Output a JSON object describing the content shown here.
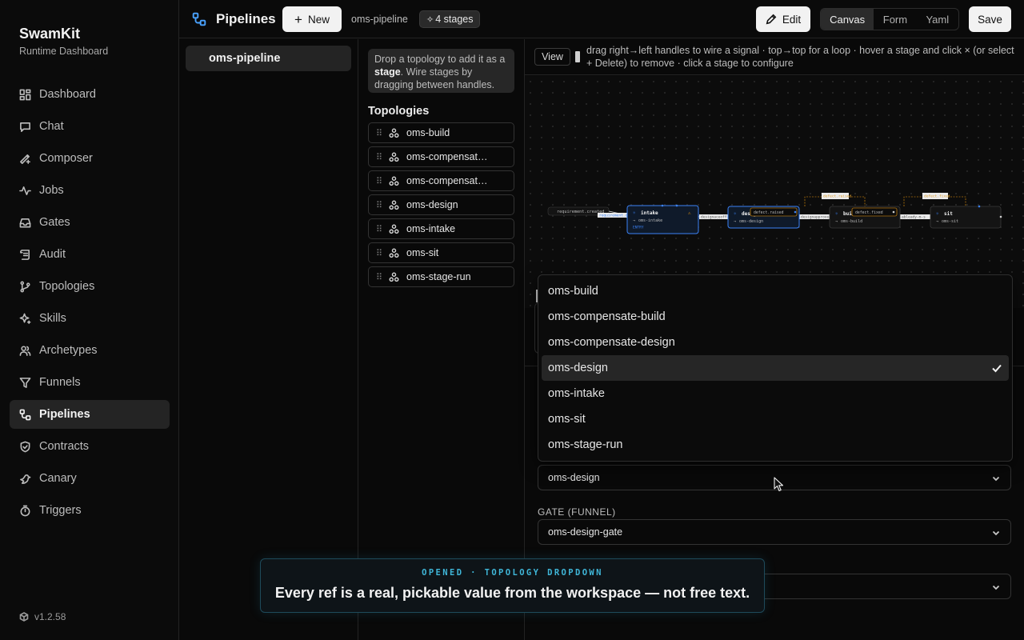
{
  "brand": {
    "name": "SwamKit",
    "subtitle": "Runtime Dashboard",
    "version": "v1.2.58"
  },
  "nav": [
    {
      "label": "Dashboard",
      "icon": "dashboard-icon",
      "active": false
    },
    {
      "label": "Chat",
      "icon": "chat-icon",
      "active": false
    },
    {
      "label": "Composer",
      "icon": "composer-icon",
      "active": false
    },
    {
      "label": "Jobs",
      "icon": "activity-icon",
      "active": false
    },
    {
      "label": "Gates",
      "icon": "inbox-icon",
      "active": false
    },
    {
      "label": "Audit",
      "icon": "scroll-icon",
      "active": false
    },
    {
      "label": "Topologies",
      "icon": "git-branch-icon",
      "active": false
    },
    {
      "label": "Skills",
      "icon": "sparkles-icon",
      "active": false
    },
    {
      "label": "Archetypes",
      "icon": "users-icon",
      "active": false
    },
    {
      "label": "Funnels",
      "icon": "funnel-icon",
      "active": false
    },
    {
      "label": "Pipelines",
      "icon": "workflow-icon",
      "active": true
    },
    {
      "label": "Contracts",
      "icon": "shield-icon",
      "active": false
    },
    {
      "label": "Canary",
      "icon": "bird-icon",
      "active": false
    },
    {
      "label": "Triggers",
      "icon": "timer-icon",
      "active": false
    }
  ],
  "header": {
    "title": "Pipelines",
    "new_label": "New",
    "pipeline_name": "oms-pipeline",
    "stages_badge": "4 stages",
    "edit_label": "Edit",
    "views": [
      "Canvas",
      "Form",
      "Yaml"
    ],
    "active_view": "Canvas",
    "save_label": "Save"
  },
  "pipelines": [
    {
      "label": "oms-pipeline",
      "active": true
    }
  ],
  "topologies_panel": {
    "hint_prefix": "Drop a topology to add it as a ",
    "hint_bold": "stage",
    "hint_suffix": ". Wire stages by dragging between handles.",
    "heading": "Topologies",
    "items": [
      "oms-build",
      "oms-compensate-build",
      "oms-compensate-design",
      "oms-design",
      "oms-intake",
      "oms-sit",
      "oms-stage-run"
    ]
  },
  "canvas_toolbar": {
    "view_label": "View",
    "help_text": "drag right→left handles to wire a signal · top→top for a loop · hover a stage and click × (or select + Delete) to remove · click a stage to configure"
  },
  "graph": {
    "trigger_label": "requirement.created",
    "edge_labels": [
      "requirement.cre",
      "designaceoff",
      "designapprove",
      "ableady-m-s"
    ],
    "loop_labels": [
      "defect.raised",
      "defect.fixed",
      "defect.raised",
      "defect.fixed"
    ],
    "stages": [
      {
        "name": "intake",
        "topology": "oms-intake",
        "entry": "ENTRY"
      },
      {
        "name": "design",
        "topology": "oms-design"
      },
      {
        "name": "build",
        "topology": "oms-build"
      },
      {
        "name": "sit",
        "topology": "oms-sit"
      }
    ],
    "colors": {
      "accent": "#3b82f6",
      "warning": "#f59e0b"
    }
  },
  "config": {
    "topology_value": "oms-design",
    "gate_label": "GATE (FUNNEL)",
    "gate_value": "oms-design-gate"
  },
  "dropdown": {
    "options": [
      "oms-build",
      "oms-compensate-build",
      "oms-compensate-design",
      "oms-design",
      "oms-intake",
      "oms-sit",
      "oms-stage-run"
    ],
    "selected": "oms-design"
  },
  "caption": {
    "kicker": "OPENED · TOPOLOGY DROPDOWN",
    "text": "Every ref is a real, pickable value from the workspace — not free text."
  }
}
